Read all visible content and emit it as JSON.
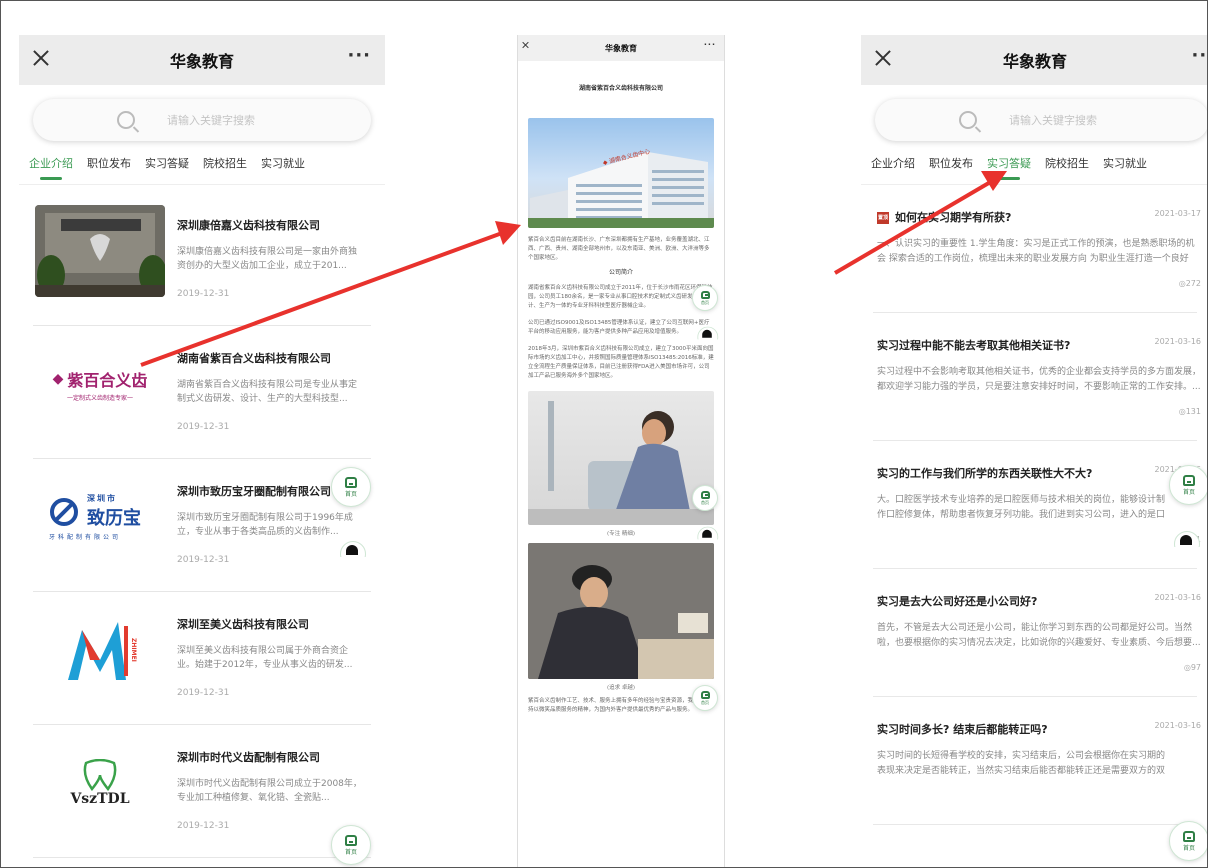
{
  "app": {
    "title": "华象教育",
    "more": "···"
  },
  "search": {
    "placeholder": "请输入关键字搜索"
  },
  "tabs": [
    "企业介绍",
    "职位发布",
    "实习答疑",
    "院校招生",
    "实习就业"
  ],
  "home_label": "首页",
  "companies": [
    {
      "name": "深圳康倍嘉义齿科技有限公司",
      "desc": "深圳康倍嘉义齿科技有限公司是一家由外商独资创办的大型义齿加工企业，成立于201...",
      "date": "2019-12-31"
    },
    {
      "name": "湖南省紫百合义齿科技有限公司",
      "desc": "湖南省紫百合义齿科技有限公司是专业从事定制式义齿研发、设计、生产的大型科技型...",
      "date": "2019-12-31",
      "logo_text": "紫百合义齿",
      "logo_sub": "一定制式义齿制造专家一"
    },
    {
      "name": "深圳市致历宝牙圈配制有限公司",
      "desc": "深圳市致历宝牙圈配制有限公司于1996年成立，专业从事于各类高品质的义齿制作...",
      "date": "2019-12-31",
      "logo_city": "深圳市",
      "logo_text": "致历宝",
      "logo_sub": "牙科配制有限公司"
    },
    {
      "name": "深圳至美义齿科技有限公司",
      "desc": "深圳至美义齿科技有限公司属于外商合资企业。始建于2012年，专业从事义齿的研发...",
      "date": "2019-12-31",
      "logo_text": "ZHIMEI"
    },
    {
      "name": "深圳市时代义齿配制有限公司",
      "desc": "深圳市时代义齿配制有限公司成立于2008年，专业加工种植修复、氧化锆、全瓷贴...",
      "date": "2019-12-31",
      "logo_text": "VszTDL"
    }
  ],
  "article": {
    "title": "湖南省紫百合义齿科技有限公司",
    "building_sign": "◆ 湖南合义齿中心",
    "intro": "紫百合义齿目前在湖南长沙、广东深圳都拥有生产基地，业务覆盖湖北、江西、广西、贵州、湖南全部地州市，以及东南亚、美洲、欧洲、大洋洲等多个国家地区。",
    "subhead": "公司简介",
    "p1": "湖南省紫百合义齿科技有限公司成立于2011年，位于长沙市雨花区环保科技园，公司员工180余名，是一家专业从事口腔技术的定制式义齿研发、设计、生产为一体的专业牙科科技型医疗器械企业。",
    "p2": "公司已通过ISO9001及ISO13485管理体系认证，建立了公司互联网+医疗平台的移动应用服务，能为客户提供多种产品应用及增值服务。",
    "p3": "2018年3月，深圳市紫百合义齿科技有限公司成立，建立了3000平米面向国际市场的义齿加工中心，并按照国际质量管理体系ISO13485:2016标准，建立全流程生产质量保证体系，目前已注册获得FDA进入美国市场许可，公司加工产品已服务海外多个国家地区。",
    "caption1": "(专注 精细)",
    "caption2": "(追求 卓越)",
    "p4": "紫百合义齿制作工艺、技术、服务上拥有多年的经验与宝贵资源，我们将坚持以微笑品质服务的精神，为国内外客户提供最优秀的产品与服务。"
  },
  "qa_items": [
    {
      "q": "如何在实习期学有所获?",
      "badge": "置顶",
      "date": "2021-03-17",
      "a": "一、认识实习的重要性 1.学生角度：实习是正式工作的预演，也是熟悉职场的机会 探索合适的工作岗位，梳理出未来的职业发展方向 为职业生涯打造一个良好的...",
      "views": "272"
    },
    {
      "q": "实习过程中能不能去考取其他相关证书?",
      "date": "2021-03-16",
      "a": "实习过程中不会影响考取其他相关证书，优秀的企业都会支持学员的多方面发展，都欢迎学习能力强的学员，只是要注意安排好时间，不要影响正常的工作安排。...",
      "views": "131"
    },
    {
      "q": "实习的工作与我们所学的东西关联性大不大?",
      "date": "2021-03-16",
      "a": "大。口腔医学技术专业培养的是口腔医师与技术相关的岗位，能够设计制作口腔修复体，帮助患者恢复牙列功能。我们进到实习公司，进入的是口腔技师一岗位...",
      "views": "61"
    },
    {
      "q": "实习是去大公司好还是小公司好?",
      "date": "2021-03-16",
      "a": "首先，不管是去大公司还是小公司，能让你学习到东西的公司都是好公司。当然啦，也要根据你的实习情况去决定，比如说你的兴趣爱好、专业素质、今后想要...",
      "views": "97"
    },
    {
      "q": "实习时间多长? 结束后都能转正吗?",
      "date": "2021-03-16",
      "a": "实习时间的长短得看学校的安排，实习结束后，公司会根据你在实习期的表现来决定是否能转正，当然实习结束后能否都能转正还是需要双方的双向选择。",
      "views": ""
    }
  ],
  "colors": {
    "accent": "#3a9a52",
    "arrow": "#e8322d",
    "badge": "#c0392b"
  }
}
